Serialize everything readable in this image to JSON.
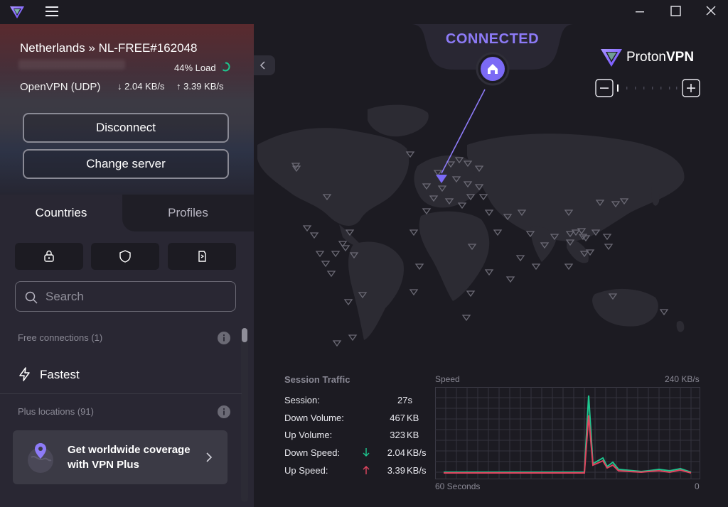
{
  "titlebar": {
    "logo": "protonvpn-logo-icon",
    "menu_icon": "hamburger-icon",
    "window_controls": [
      "minimize-icon",
      "maximize-icon",
      "close-icon"
    ]
  },
  "connection": {
    "server": "Netherlands » NL-FREE#162048",
    "load": "44% Load",
    "protocol": "OpenVPN (UDP)",
    "download_rate": "2.04 KB/s",
    "upload_rate": "3.39 KB/s",
    "disconnect_label": "Disconnect",
    "change_server_label": "Change server"
  },
  "tabs": {
    "countries": "Countries",
    "profiles": "Profiles",
    "active": "countries"
  },
  "filters": [
    "secure-core-lock-icon",
    "shield-icon",
    "smartphone-icon"
  ],
  "search": {
    "placeholder": "Search",
    "value": ""
  },
  "list": {
    "free_header": "Free connections (1)",
    "fastest_label": "Fastest",
    "plus_header": "Plus locations (91)",
    "upsell_line1": "Get worldwide coverage",
    "upsell_line2": "with VPN Plus"
  },
  "status": {
    "state": "CONNECTED",
    "brand_a": "Proton",
    "brand_b": "VPN"
  },
  "session_traffic": {
    "title": "Session Traffic",
    "rows": [
      {
        "label": "Session:",
        "value": "27s",
        "unit": ""
      },
      {
        "label": "Down Volume:",
        "value": "467",
        "unit": "KB"
      },
      {
        "label": "Up Volume:",
        "value": "323",
        "unit": "KB"
      },
      {
        "label": "Down Speed:",
        "value": "2.04",
        "unit": "KB/s"
      },
      {
        "label": "Up Speed:",
        "value": "3.39",
        "unit": "KB/s"
      }
    ]
  },
  "speed_graph": {
    "title": "Speed",
    "max_label": "240  KB/s",
    "x_start": "60 Seconds",
    "x_end": "0"
  },
  "colors": {
    "accent": "#8d7bf7",
    "download": "#1ec78f",
    "upload": "#e0455f",
    "panel": "#292733",
    "background": "#1c1b22"
  }
}
